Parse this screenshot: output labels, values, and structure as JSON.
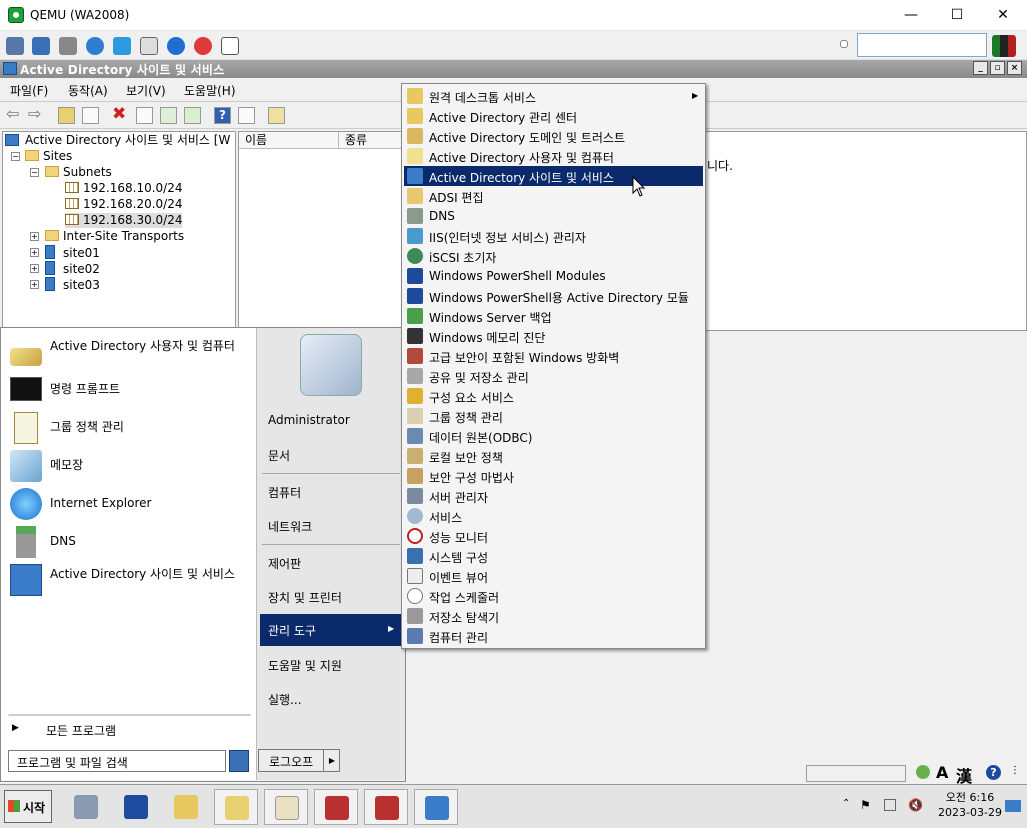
{
  "qemu": {
    "title": "QEMU (WA2008)",
    "min": "—",
    "max": "☐",
    "close": "✕",
    "search_value": ""
  },
  "mmc": {
    "title": "Active Directory 사이트 및 서비스",
    "menu": [
      "파일(F)",
      "동작(A)",
      "보기(V)",
      "도움말(H)"
    ],
    "tree": {
      "root": "Active Directory 사이트 및 서비스 [W",
      "sites": "Sites",
      "subnets": "Subnets",
      "subnet_items": [
        "192.168.10.0/24",
        "192.168.20.0/24",
        "192.168.30.0/24"
      ],
      "transports": "Inter-Site Transports",
      "site_items": [
        "site01",
        "site02",
        "site03"
      ]
    },
    "columns": [
      "이름",
      "종류"
    ],
    "right_text": "니다."
  },
  "startmenu": {
    "pinned": [
      "Active Directory 사용자 및 컴퓨터",
      "명령 프롬프트",
      "그룹 정책 관리",
      "메모장",
      "Internet Explorer",
      "DNS",
      "Active Directory 사이트 및 서비스"
    ],
    "all_programs": "모든 프로그램",
    "search_placeholder": "프로그램 및 파일 검색",
    "right": {
      "user": "Administrator",
      "documents": "문서",
      "computer": "컴퓨터",
      "network": "네트워크",
      "control_panel": "제어판",
      "devices": "장치 및 프린터",
      "admin_tools": "관리 도구",
      "help": "도움말 및 지원",
      "run": "실행..."
    },
    "logoff": "로그오프"
  },
  "submenu": [
    "원격 데스크톱 서비스",
    "Active Directory 관리 센터",
    "Active Directory 도메인 및 트러스트",
    "Active Directory 사용자 및 컴퓨터",
    "Active Directory 사이트 및 서비스",
    "ADSI 편집",
    "DNS",
    "IIS(인터넷 정보 서비스) 관리자",
    "iSCSI 초기자",
    "Windows PowerShell Modules",
    "Windows PowerShell용 Active Directory 모듈",
    "Windows Server 백업",
    "Windows 메모리 진단",
    "고급 보안이 포함된 Windows 방화벽",
    "공유 및 저장소 관리",
    "구성 요소 서비스",
    "그룹 정책 관리",
    "데이터 원본(ODBC)",
    "로컬 보안 정책",
    "보안 구성 마법사",
    "서버 관리자",
    "서비스",
    "성능 모니터",
    "시스템 구성",
    "이벤트 뷰어",
    "작업 스케줄러",
    "저장소 탐색기",
    "컴퓨터 관리"
  ],
  "taskbar": {
    "start": "시작",
    "time": "오전 6:16",
    "date": "2023-03-29"
  },
  "colors": {
    "highlight": "#0b2a6b",
    "title_gray": "#8a8a8a"
  }
}
